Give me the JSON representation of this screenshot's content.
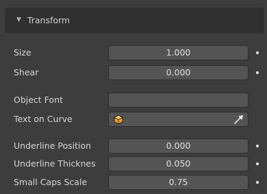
{
  "panel": {
    "title": "Transform",
    "expanded_icon": "disclosure-triangle-down-icon"
  },
  "rows": {
    "size": {
      "label": "Size",
      "value": "1.000"
    },
    "shear": {
      "label": "Shear",
      "value": "0.000"
    },
    "object_font": {
      "label": "Object Font",
      "value": ""
    },
    "text_on_curve": {
      "label": "Text on Curve",
      "value": "",
      "icons": [
        "object-icon",
        "eyedropper-icon"
      ]
    },
    "underline_position": {
      "label": "Underline Position",
      "value": "0.000"
    },
    "underline_thickness": {
      "label": "Underline Thicknes",
      "value": "0.050"
    },
    "small_caps_scale": {
      "label": "Small Caps Scale",
      "value": "0.75"
    }
  },
  "colors": {
    "background": "#3d3d3d",
    "header": "#303030",
    "field": "#545454",
    "object_icon": "#f0a030"
  }
}
